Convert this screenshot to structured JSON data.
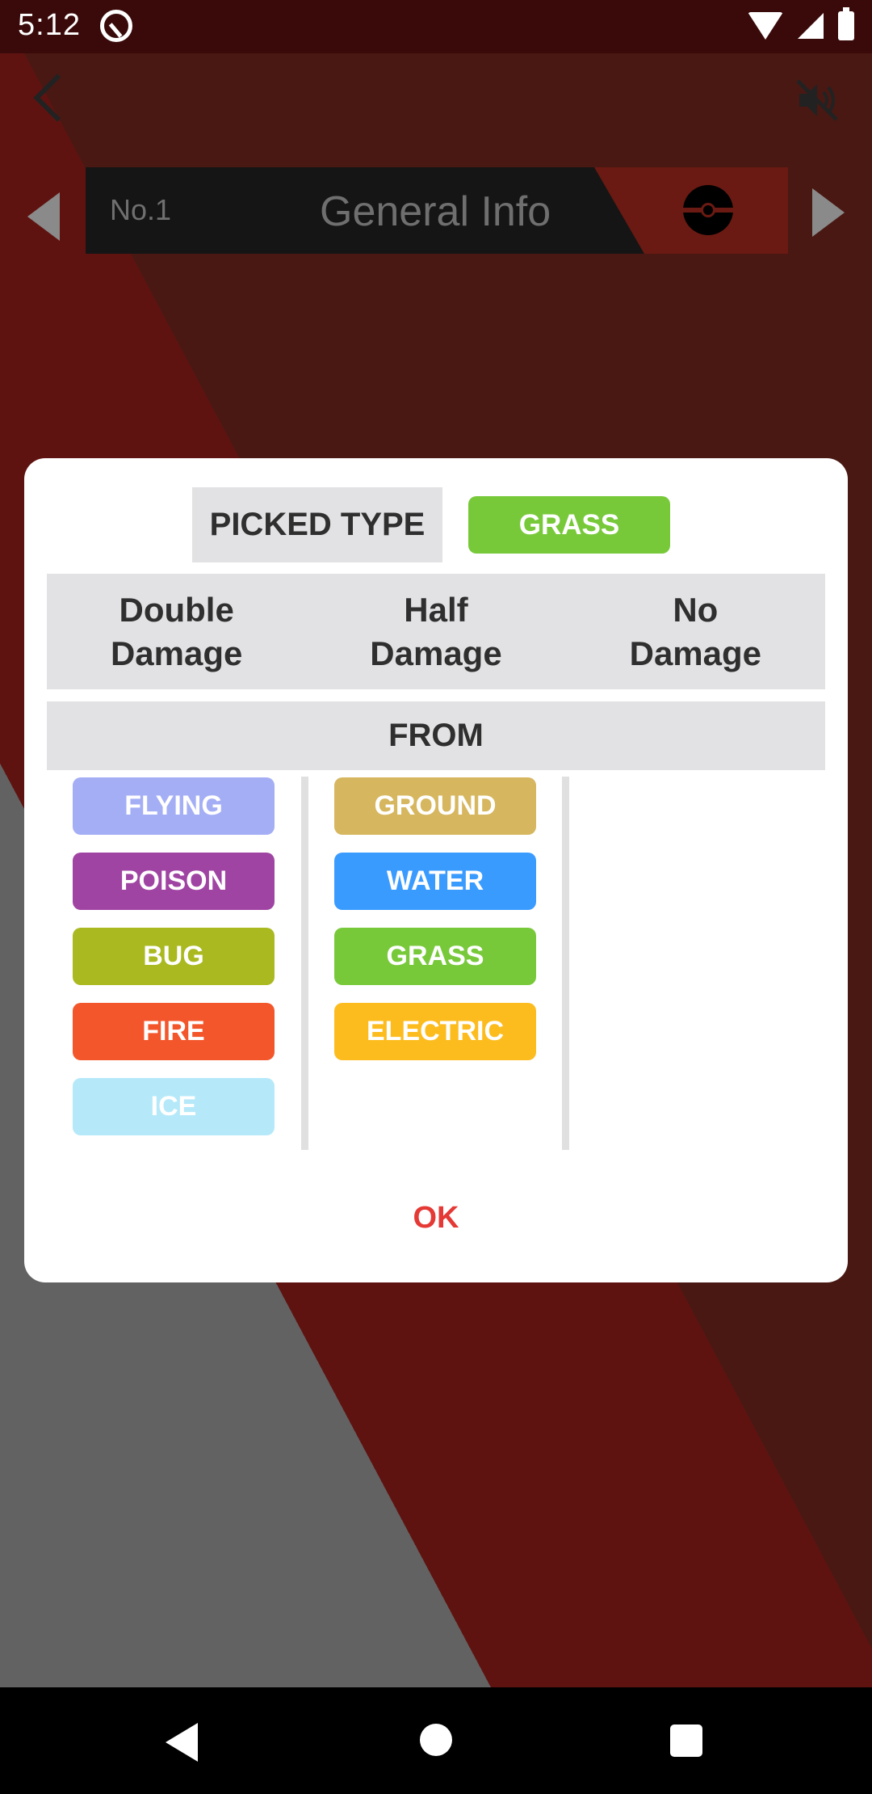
{
  "status_bar": {
    "time": "5:12"
  },
  "app": {
    "info_bar": {
      "number": "No.1",
      "title": "General Info"
    }
  },
  "dialog": {
    "picked_label": "PICKED TYPE",
    "picked_type": {
      "label": "GRASS",
      "color": "#78c93a"
    },
    "headers": [
      "Double\nDamage",
      "Half\nDamage",
      "No\nDamage"
    ],
    "from_label": "FROM",
    "double_damage": [
      {
        "label": "FLYING",
        "color": "#a4aef5"
      },
      {
        "label": "POISON",
        "color": "#a044a3"
      },
      {
        "label": "BUG",
        "color": "#aab91f"
      },
      {
        "label": "FIRE",
        "color": "#f4562b"
      },
      {
        "label": "ICE",
        "color": "#b5e9f9"
      }
    ],
    "half_damage": [
      {
        "label": "GROUND",
        "color": "#d6b65e"
      },
      {
        "label": "WATER",
        "color": "#3a9bff"
      },
      {
        "label": "GRASS",
        "color": "#78c93a"
      },
      {
        "label": "ELECTRIC",
        "color": "#fdbc1e"
      }
    ],
    "no_damage": [],
    "ok_label": "OK"
  }
}
